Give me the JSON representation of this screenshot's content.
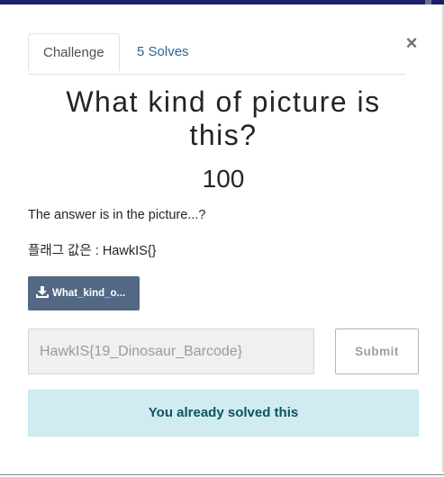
{
  "tabs": {
    "challenge": "Challenge",
    "solves": "5 Solves"
  },
  "close": {
    "glyph": "×"
  },
  "challenge": {
    "title": "What kind of picture is this?",
    "points": "100",
    "description_line1": "The answer is in the picture...?",
    "description_line2": "플래그 값은 : HawkIS{}",
    "file_label": "What_kind_o..."
  },
  "flag": {
    "value": "HawkIS{19_Dinosaur_Barcode}"
  },
  "actions": {
    "submit_label": "Submit"
  },
  "status": {
    "solved_message": "You already solved this"
  },
  "icons": {
    "download": "download-icon",
    "close": "close-icon"
  },
  "colors": {
    "tab_link": "#2a6496",
    "file_button": "#536884",
    "notice_bg": "#d1ecf1",
    "notice_text": "#0c5460",
    "top_bar": "#1a1f6b"
  }
}
